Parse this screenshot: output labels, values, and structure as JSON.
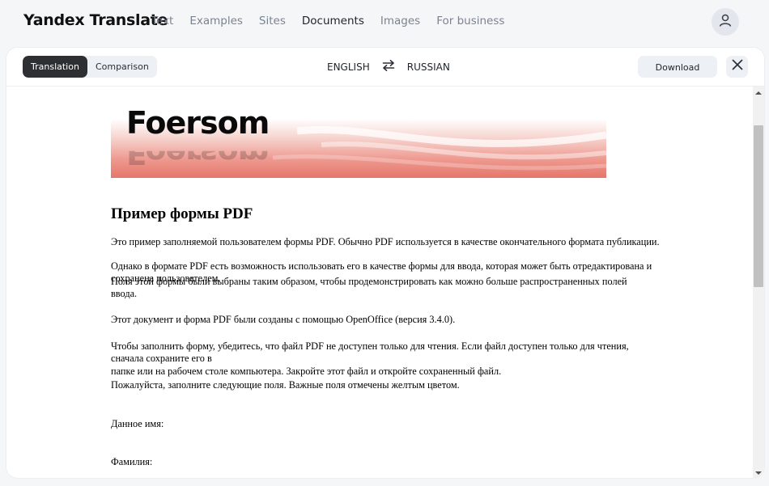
{
  "app": {
    "title": "Yandex Translate"
  },
  "nav": {
    "items": [
      {
        "label": "Text"
      },
      {
        "label": "Examples"
      },
      {
        "label": "Sites"
      },
      {
        "label": "Documents",
        "active": true
      },
      {
        "label": "Images"
      },
      {
        "label": "For business"
      }
    ]
  },
  "toolbar": {
    "mode_tabs": [
      {
        "label": "Translation",
        "active": true
      },
      {
        "label": "Comparison"
      }
    ],
    "source_lang": "ENGLISH",
    "target_lang": "RUSSIAN",
    "download_label": "Download"
  },
  "icons": {
    "avatar": "user-icon",
    "swap": "swap-arrows-icon",
    "close": "close-icon"
  },
  "document": {
    "banner_logo": "Foersom",
    "title": "Пример формы PDF",
    "paragraphs": [
      "Это пример заполняемой пользователем формы PDF. Обычно PDF используется в качестве окончательного формата публикации.",
      "Однако в формате PDF есть возможность использовать его в качестве формы для ввода, которая может быть отредактирована и сохранена пользователем.",
      "Поля этой формы были выбраны таким образом, чтобы продемонстрировать как можно больше распространенных полей ввода.",
      "Этот документ и форма PDF были созданы с помощью OpenOffice (версия 3.4.0).",
      "Чтобы заполнить форму, убедитесь, что файл PDF не доступен только для чтения. Если файл доступен только для чтения, сначала сохраните его в",
      "папке или на рабочем столе компьютера. Закройте этот файл и откройте сохраненный файл.",
      "Пожалуйста, заполните следующие поля. Важные поля отмечены желтым цветом.",
      "Данное имя:",
      "Фамилия:"
    ]
  },
  "colors": {
    "page_bg": "#f5f6f8",
    "active_tab_bg": "#2d2f33",
    "button_bg": "#edf0f4",
    "banner_red": "#e5766b"
  }
}
